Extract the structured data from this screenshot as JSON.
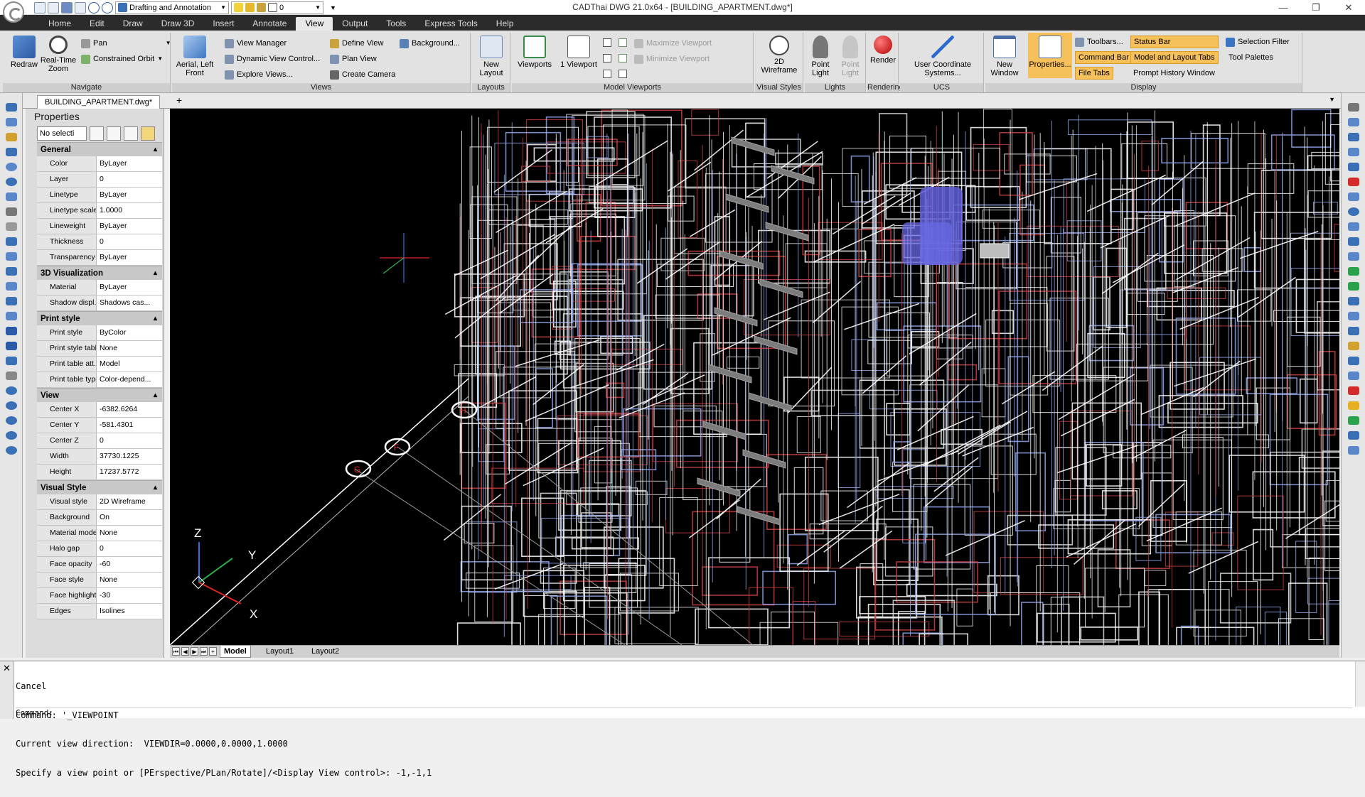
{
  "app": {
    "window_title": "CADThai DWG 21.0x64 - [BUILDING_APARTMENT.dwg*]",
    "workspace": "Drafting and Annotation",
    "current_layer": "0",
    "logo_icon": "cadthai-logo-icon"
  },
  "window_controls": {
    "minimize": "—",
    "restore": "❐",
    "close": "✕"
  },
  "menu": [
    "Home",
    "Edit",
    "Draw",
    "Draw 3D",
    "Insert",
    "Annotate",
    "View",
    "Output",
    "Tools",
    "Express Tools",
    "Help"
  ],
  "menu_active": "View",
  "ribbon": {
    "navigate": {
      "title": "Navigate",
      "redraw": "Redraw",
      "realtime_zoom": "Real-Time Zoom",
      "pan": "Pan",
      "constrained_orbit": "Constrained Orbit"
    },
    "views": {
      "title": "Views",
      "aerial": "Aerial, Left Front",
      "view_manager": "View Manager",
      "dynamic_view": "Dynamic View Control...",
      "explore_views": "Explore Views...",
      "define_view": "Define View",
      "plan_view": "Plan View",
      "create_camera": "Create Camera",
      "background": "Background..."
    },
    "layouts": {
      "title": "Layouts",
      "new_layout": "New Layout"
    },
    "model_viewports": {
      "title": "Model Viewports",
      "viewports": "Viewports",
      "one_viewport": "1 Viewport",
      "maximize_viewport": "Maximize Viewport",
      "minimize_viewport": "Minimize Viewport"
    },
    "visual_styles": {
      "title": "Visual Styles",
      "wireframe": "2D Wireframe"
    },
    "lights": {
      "title": "Lights",
      "point_light": "Point Light",
      "point_light2": "Point Light"
    },
    "rendering": {
      "title": "Rendering",
      "render": "Render"
    },
    "ucs": {
      "title": "UCS",
      "user_coordinate": "User Coordinate Systems..."
    },
    "display": {
      "title": "Display",
      "new_window": "New Window",
      "properties": "Properties...",
      "toolbars": "Toolbars...",
      "command_bar": "Command Bar",
      "file_tabs": "File Tabs",
      "status_bar": "Status Bar",
      "model_layout_tabs": "Model and Layout Tabs",
      "prompt_history": "Prompt History Window",
      "selection_filter": "Selection Filter",
      "tool_palettes": "Tool Palettes"
    }
  },
  "document_tab": "BUILDING_APARTMENT.dwg*",
  "properties": {
    "title": "Properties",
    "selection": "No selecti",
    "sections": [
      {
        "name": "General",
        "rows": [
          {
            "label": "Color",
            "value": "ByLayer"
          },
          {
            "label": "Layer",
            "value": "0"
          },
          {
            "label": "Linetype",
            "value": "ByLayer"
          },
          {
            "label": "Linetype scale",
            "value": "1.0000"
          },
          {
            "label": "Lineweight",
            "value": "ByLayer"
          },
          {
            "label": "Thickness",
            "value": "0"
          },
          {
            "label": "Transparency",
            "value": "ByLayer"
          }
        ]
      },
      {
        "name": "3D Visualization",
        "rows": [
          {
            "label": "Material",
            "value": "ByLayer"
          },
          {
            "label": "Shadow displ...",
            "value": "Shadows cas..."
          }
        ]
      },
      {
        "name": "Print style",
        "rows": [
          {
            "label": "Print style",
            "value": "ByColor"
          },
          {
            "label": "Print style table",
            "value": "None"
          },
          {
            "label": "Print table att...",
            "value": "Model"
          },
          {
            "label": "Print table type",
            "value": "Color-depend..."
          }
        ]
      },
      {
        "name": "View",
        "rows": [
          {
            "label": "Center X",
            "value": "-6382.6264"
          },
          {
            "label": "Center Y",
            "value": "-581.4301"
          },
          {
            "label": "Center Z",
            "value": "0"
          },
          {
            "label": "Width",
            "value": "37730.1225"
          },
          {
            "label": "Height",
            "value": "17237.5772"
          }
        ]
      },
      {
        "name": "Visual Style",
        "rows": [
          {
            "label": "Visual style",
            "value": "2D Wireframe"
          },
          {
            "label": "Background",
            "value": "On"
          },
          {
            "label": "Material mode",
            "value": "None"
          },
          {
            "label": "Halo gap",
            "value": "0"
          },
          {
            "label": "Face opacity",
            "value": "-60"
          },
          {
            "label": "Face style",
            "value": "None"
          },
          {
            "label": "Face highlight",
            "value": "-30"
          },
          {
            "label": "Edges",
            "value": "Isolines"
          }
        ]
      }
    ]
  },
  "canvas": {
    "axis_z": "Z",
    "axis_y": "Y",
    "axis_x": "X",
    "grid_bubbles": [
      "H",
      "F",
      "G"
    ]
  },
  "layout_tabs": [
    "Model",
    "Layout1",
    "Layout2"
  ],
  "command": {
    "history": [
      "Cancel",
      "Command: '_VIEWPOINT",
      "Current view direction:  VIEWDIR=0.0000,0.0000,1.0000",
      "Specify a view point or [PErspective/PLan/Rotate]/<Display View control>: -1,-1,1"
    ],
    "prompt": "Command:"
  },
  "colors": {
    "accent": "#f6c05a",
    "menubar": "#2b2b2b",
    "canvas": "#000000"
  }
}
